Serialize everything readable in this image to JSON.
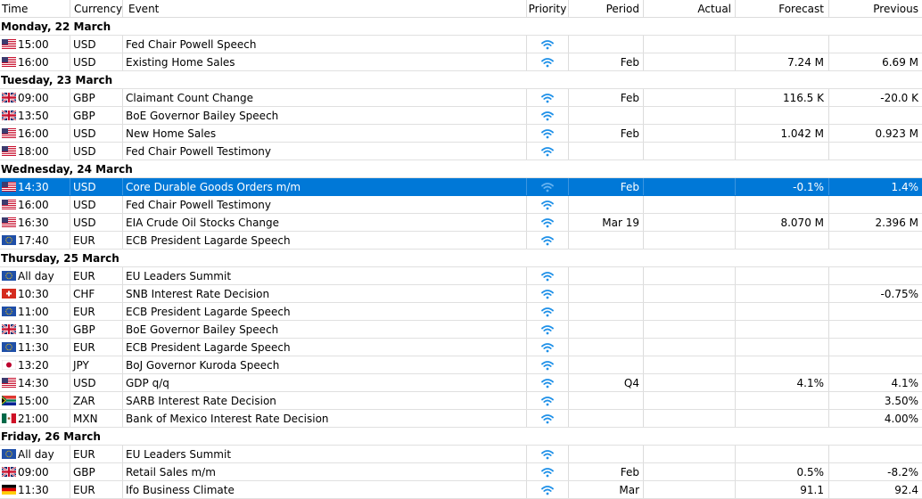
{
  "columns": {
    "time": "Time",
    "currency": "Currency",
    "event": "Event",
    "priority": "Priority",
    "period": "Period",
    "actual": "Actual",
    "forecast": "Forecast",
    "previous": "Previous"
  },
  "colors": {
    "selected": "#0078d7",
    "priority_icon": "#1e90e8"
  },
  "days": [
    {
      "label": "Monday, 22 March",
      "events": [
        {
          "flag": "us",
          "time": "15:00",
          "currency": "USD",
          "event": "Fed Chair Powell Speech",
          "period": "",
          "actual": "",
          "forecast": "",
          "previous": ""
        },
        {
          "flag": "us",
          "time": "16:00",
          "currency": "USD",
          "event": "Existing Home Sales",
          "period": "Feb",
          "actual": "",
          "forecast": "7.24 M",
          "previous": "6.69 M"
        }
      ]
    },
    {
      "label": "Tuesday, 23 March",
      "events": [
        {
          "flag": "gb",
          "time": "09:00",
          "currency": "GBP",
          "event": "Claimant Count Change",
          "period": "Feb",
          "actual": "",
          "forecast": "116.5 K",
          "previous": "-20.0 K"
        },
        {
          "flag": "gb",
          "time": "13:50",
          "currency": "GBP",
          "event": "BoE Governor Bailey Speech",
          "period": "",
          "actual": "",
          "forecast": "",
          "previous": ""
        },
        {
          "flag": "us",
          "time": "16:00",
          "currency": "USD",
          "event": "New Home Sales",
          "period": "Feb",
          "actual": "",
          "forecast": "1.042 M",
          "previous": "0.923 M"
        },
        {
          "flag": "us",
          "time": "18:00",
          "currency": "USD",
          "event": "Fed Chair Powell Testimony",
          "period": "",
          "actual": "",
          "forecast": "",
          "previous": ""
        }
      ]
    },
    {
      "label": "Wednesday, 24 March",
      "events": [
        {
          "flag": "us",
          "time": "14:30",
          "currency": "USD",
          "event": "Core Durable Goods Orders m/m",
          "period": "Feb",
          "actual": "",
          "forecast": "-0.1%",
          "previous": "1.4%",
          "selected": true
        },
        {
          "flag": "us",
          "time": "16:00",
          "currency": "USD",
          "event": "Fed Chair Powell Testimony",
          "period": "",
          "actual": "",
          "forecast": "",
          "previous": ""
        },
        {
          "flag": "us",
          "time": "16:30",
          "currency": "USD",
          "event": "EIA Crude Oil Stocks Change",
          "period": "Mar 19",
          "actual": "",
          "forecast": "8.070 M",
          "previous": "2.396 M"
        },
        {
          "flag": "eu",
          "time": "17:40",
          "currency": "EUR",
          "event": "ECB President Lagarde Speech",
          "period": "",
          "actual": "",
          "forecast": "",
          "previous": ""
        }
      ]
    },
    {
      "label": "Thursday, 25 March",
      "events": [
        {
          "flag": "eu",
          "time": "All day",
          "currency": "EUR",
          "event": "EU Leaders Summit",
          "period": "",
          "actual": "",
          "forecast": "",
          "previous": ""
        },
        {
          "flag": "ch",
          "time": "10:30",
          "currency": "CHF",
          "event": "SNB Interest Rate Decision",
          "period": "",
          "actual": "",
          "forecast": "",
          "previous": "-0.75%"
        },
        {
          "flag": "eu",
          "time": "11:00",
          "currency": "EUR",
          "event": "ECB President Lagarde Speech",
          "period": "",
          "actual": "",
          "forecast": "",
          "previous": ""
        },
        {
          "flag": "gb",
          "time": "11:30",
          "currency": "GBP",
          "event": "BoE Governor Bailey Speech",
          "period": "",
          "actual": "",
          "forecast": "",
          "previous": ""
        },
        {
          "flag": "eu",
          "time": "11:30",
          "currency": "EUR",
          "event": "ECB President Lagarde Speech",
          "period": "",
          "actual": "",
          "forecast": "",
          "previous": ""
        },
        {
          "flag": "jp",
          "time": "13:20",
          "currency": "JPY",
          "event": "BoJ Governor Kuroda Speech",
          "period": "",
          "actual": "",
          "forecast": "",
          "previous": ""
        },
        {
          "flag": "us",
          "time": "14:30",
          "currency": "USD",
          "event": "GDP q/q",
          "period": "Q4",
          "actual": "",
          "forecast": "4.1%",
          "previous": "4.1%"
        },
        {
          "flag": "za",
          "time": "15:00",
          "currency": "ZAR",
          "event": "SARB Interest Rate Decision",
          "period": "",
          "actual": "",
          "forecast": "",
          "previous": "3.50%"
        },
        {
          "flag": "mx",
          "time": "21:00",
          "currency": "MXN",
          "event": "Bank of Mexico Interest Rate Decision",
          "period": "",
          "actual": "",
          "forecast": "",
          "previous": "4.00%"
        }
      ]
    },
    {
      "label": "Friday, 26 March",
      "events": [
        {
          "flag": "eu",
          "time": "All day",
          "currency": "EUR",
          "event": "EU Leaders Summit",
          "period": "",
          "actual": "",
          "forecast": "",
          "previous": ""
        },
        {
          "flag": "gb",
          "time": "09:00",
          "currency": "GBP",
          "event": "Retail Sales m/m",
          "period": "Feb",
          "actual": "",
          "forecast": "0.5%",
          "previous": "-8.2%"
        },
        {
          "flag": "de",
          "time": "11:30",
          "currency": "EUR",
          "event": "Ifo Business Climate",
          "period": "Mar",
          "actual": "",
          "forecast": "91.1",
          "previous": "92.4"
        }
      ]
    }
  ]
}
